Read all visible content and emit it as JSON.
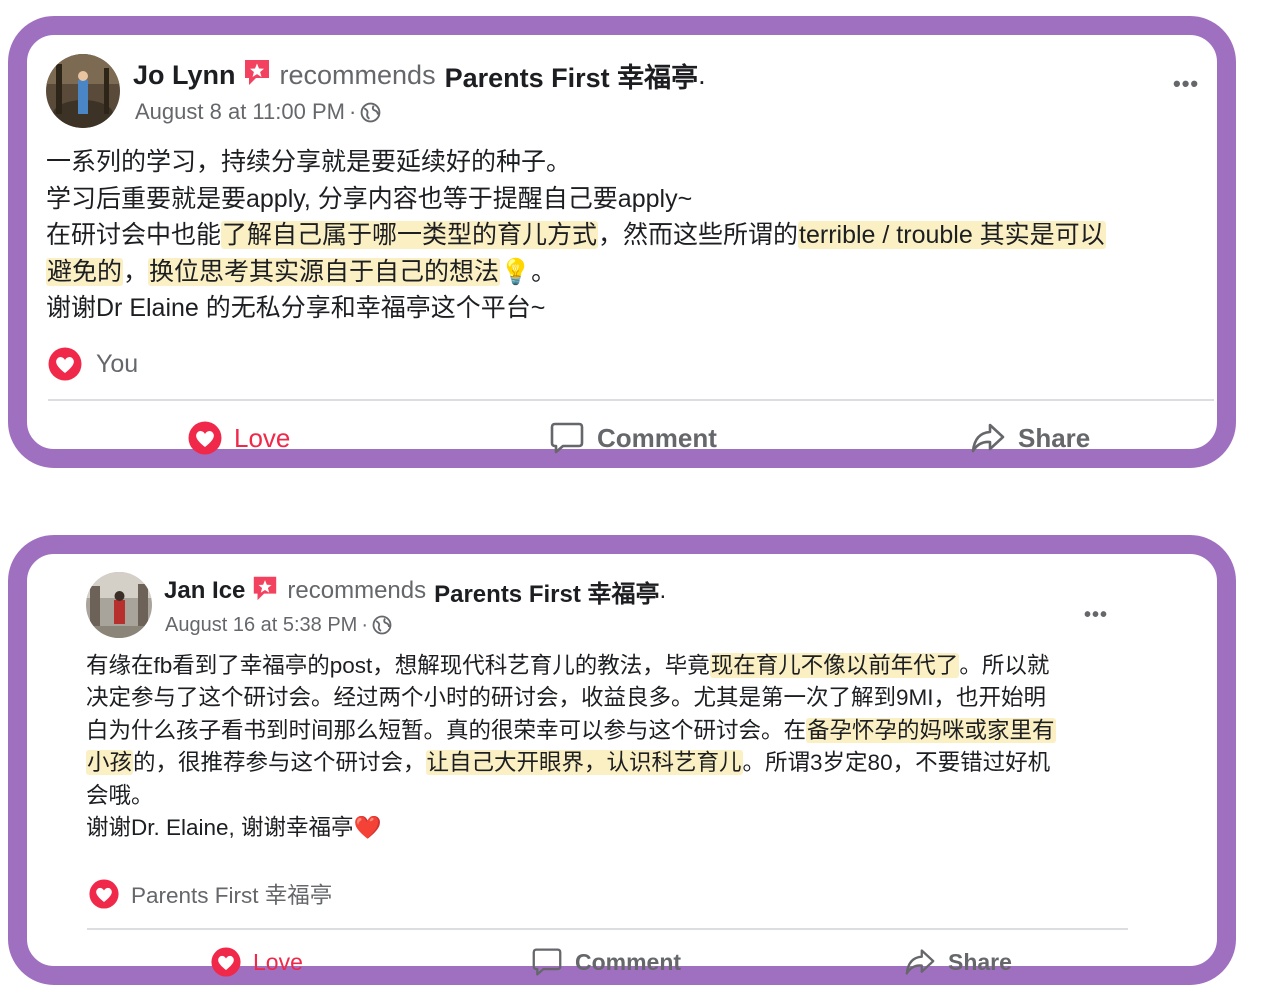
{
  "posts": [
    {
      "author": "Jo Lynn",
      "recommends_text": "recommends",
      "page_name": "Parents First 幸福亭",
      "period": ".",
      "date": "August 8 at 11:00 PM",
      "separator": "·",
      "more_label": "•••",
      "lines": [
        [
          "一系列的学习，持续分享就是要延续好的种子。"
        ],
        [
          "学习后重要就是要apply, 分享内容也等于提醒自己要apply~"
        ],
        [
          "在研讨会中也能",
          "了解自己属于哪一类型的育儿方式",
          "，然而这些所谓的",
          "terrible / trouble 其实是可以"
        ],
        [
          "避免的",
          "，",
          "换位思考其实源自于自己的想法",
          "💡。"
        ],
        [
          "谢谢Dr Elaine 的无私分享和幸福亭这个平台~"
        ]
      ],
      "reaction_text": "You",
      "actions": [
        "Love",
        "Comment",
        "Share"
      ]
    },
    {
      "author": "Jan Ice",
      "recommends_text": "recommends",
      "page_name": "Parents First 幸福亭",
      "period": ".",
      "date": "August 16 at 5:38 PM",
      "separator": "·",
      "more_label": "•••",
      "lines": [
        [
          "有缘在fb看到了幸福亭的post，想解现代科艺育儿的教法，毕竟",
          "现在育儿不像以前年代了",
          "。所以就"
        ],
        [
          "决定参与了这个研讨会。经过两个小时的研讨会，收益良多。尤其是第一次了解到9MI，也开始明"
        ],
        [
          "白为什么孩子看书到时间那么短暂。真的很荣幸可以参与这个研讨会。在",
          "备孕怀孕的妈咪或家里有"
        ],
        [
          "小孩",
          "的，很推荐参与这个研讨会，",
          "让自己大开眼界，认识科艺育儿",
          "。所谓3岁定80，不要错过好机"
        ],
        [
          "会哦。"
        ],
        [
          "谢谢Dr. Elaine, 谢谢幸福亭❤️"
        ]
      ],
      "reaction_text": "Parents First 幸福亭",
      "actions": [
        "Love",
        "Comment",
        "Share"
      ]
    }
  ],
  "colors": {
    "frame": "#a070c0",
    "love": "#f0284a",
    "highlight": "#fbf0c4",
    "muted": "#65676b",
    "badge": "#f3425f"
  },
  "icons": {
    "badge": "star-badge-icon",
    "globe": "globe-icon",
    "heart": "heart-icon",
    "comment": "comment-icon",
    "share": "share-icon"
  }
}
